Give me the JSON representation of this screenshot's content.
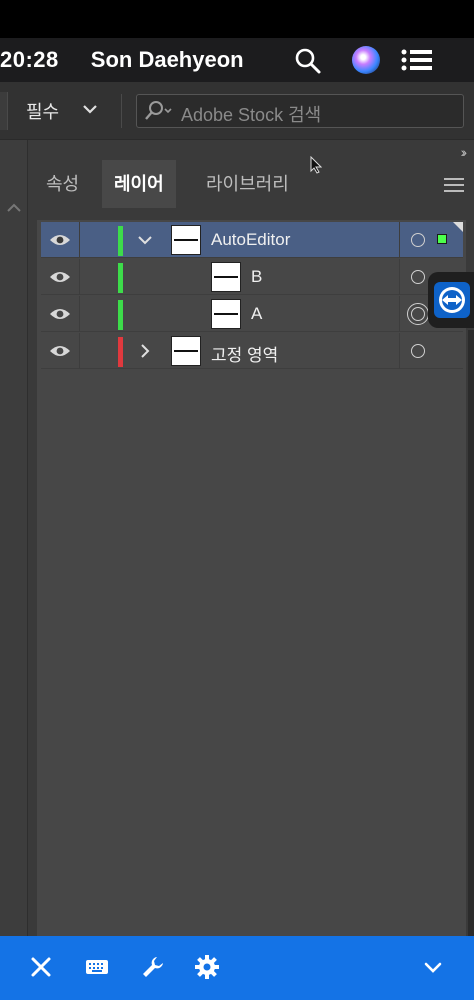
{
  "menubar": {
    "time": "20:28",
    "user": "Son Daehyeon",
    "icons": [
      "search-icon",
      "siri-icon",
      "control-center-icon"
    ]
  },
  "toolbar": {
    "workspace_label": "필수",
    "stock_search_placeholder": "Adobe Stock 검색"
  },
  "panel": {
    "collapse_label": "››",
    "tabs": [
      {
        "label": "속성",
        "active": false
      },
      {
        "label": "레이어",
        "active": true
      },
      {
        "label": "라이브러리",
        "active": false
      }
    ],
    "layers": [
      {
        "name": "AutoEditor",
        "color": "#3ddc4a",
        "expanded": true,
        "selected": true,
        "level": 0
      },
      {
        "name": "B",
        "color": "#3ddc4a",
        "selected": false,
        "level": 1
      },
      {
        "name": "A",
        "color": "#3ddc4a",
        "selected": false,
        "level": 1
      },
      {
        "name": "고정 영역",
        "color": "#e0393e",
        "expanded": false,
        "selected": false,
        "level": 0
      }
    ]
  },
  "colors": {
    "accent_blue": "#1473e6",
    "selection_row": "#4a5f85",
    "selected_square": "#4cff4c"
  },
  "bottom_bar": {
    "icons": [
      "close-icon",
      "keyboard-icon",
      "wrench-icon",
      "gear-icon",
      "chevron-down-icon"
    ]
  }
}
